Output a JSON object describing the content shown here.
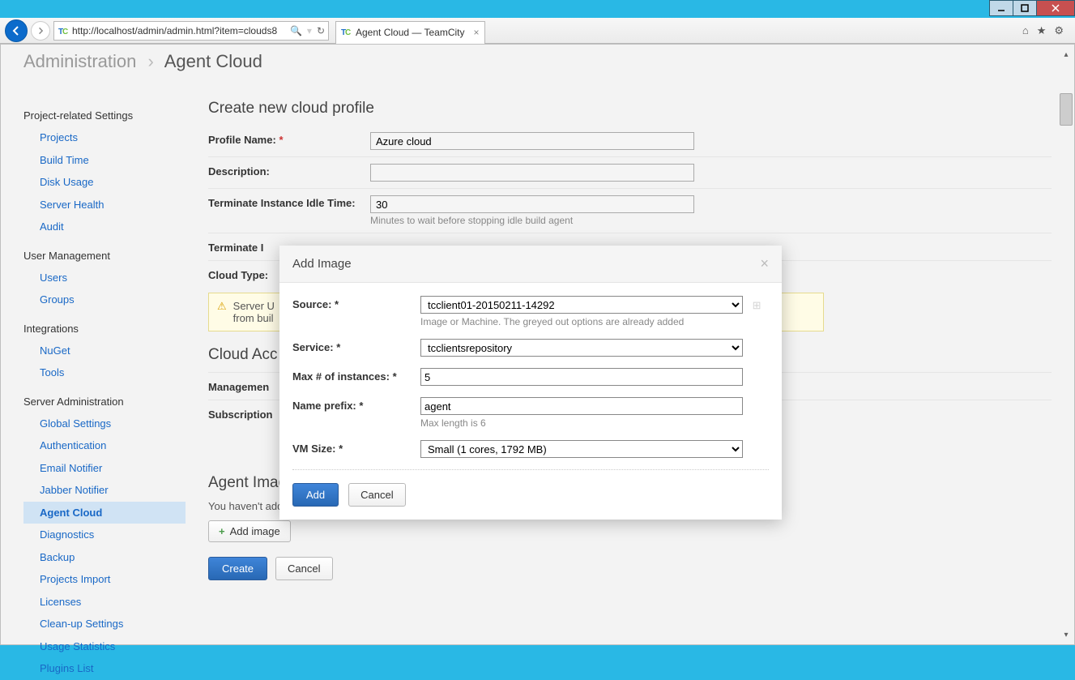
{
  "browser": {
    "url": "http://localhost/admin/admin.html?item=clouds8",
    "tab_title": "Agent Cloud — TeamCity"
  },
  "breadcrumb": {
    "root": "Administration",
    "current": "Agent Cloud"
  },
  "sidebar": {
    "groups": [
      {
        "title": "Project-related Settings",
        "items": [
          "Projects",
          "Build Time",
          "Disk Usage",
          "Server Health",
          "Audit"
        ]
      },
      {
        "title": "User Management",
        "items": [
          "Users",
          "Groups"
        ]
      },
      {
        "title": "Integrations",
        "items": [
          "NuGet",
          "Tools"
        ]
      },
      {
        "title": "Server Administration",
        "items": [
          "Global Settings",
          "Authentication",
          "Email Notifier",
          "Jabber Notifier",
          "Agent Cloud",
          "Diagnostics",
          "Backup",
          "Projects Import",
          "Licenses",
          "Clean-up Settings",
          "Usage Statistics",
          "Plugins List"
        ]
      }
    ],
    "active": "Agent Cloud"
  },
  "form": {
    "heading": "Create new cloud profile",
    "profile_name_label": "Profile Name:",
    "profile_name": "Azure cloud",
    "description_label": "Description:",
    "description": "",
    "idle_label": "Terminate Instance Idle Time:",
    "idle_value": "30",
    "idle_hint": "Minutes to wait before stopping idle build agent",
    "terminate_label": "Terminate I",
    "cloud_type_label": "Cloud Type:",
    "warning_text": "Server U                                                                                                                                                                                                          ailable from buil",
    "access_heading": "Cloud Acc",
    "management_label": "Managemen",
    "subscription_label": "Subscription",
    "images_heading": "Agent Images",
    "no_images": "You haven't added any images yet.",
    "add_image_btn": "Add image",
    "create_btn": "Create",
    "cancel_btn": "Cancel"
  },
  "modal": {
    "title": "Add Image",
    "source_label": "Source:",
    "source_value": "tcclient01-20150211-14292",
    "source_hint": "Image or Machine. The greyed out options are already added",
    "service_label": "Service:",
    "service_value": "tcclientsrepository",
    "max_label": "Max # of instances:",
    "max_value": "5",
    "prefix_label": "Name prefix:",
    "prefix_value": "agent",
    "prefix_hint": "Max length is 6",
    "vm_label": "VM Size:",
    "vm_value": "Small (1 cores, 1792 MB)",
    "add_btn": "Add",
    "cancel_btn": "Cancel"
  }
}
